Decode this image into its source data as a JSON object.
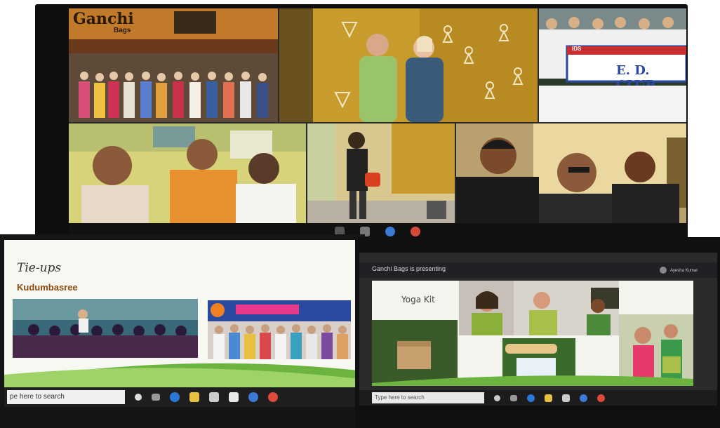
{
  "top_screen": {
    "banner_sign": "Ganchi",
    "banner_sub": "Bags",
    "banner_ed": "E. D. CLUB",
    "banner_ed_small": "IDS"
  },
  "left_presentation": {
    "title": "Tie-ups",
    "subtitle": "Kudumbasree",
    "taskbar_search": "pe here to search"
  },
  "right_presentation": {
    "header": "Ganchi Bags is presenting",
    "user": "Ayesha Kumar",
    "slide_title": "Yoga Kit",
    "taskbar_search": "Type here to search"
  },
  "colors": {
    "accent_green": "#6db33f",
    "taskbar": "#1e1e1e"
  }
}
